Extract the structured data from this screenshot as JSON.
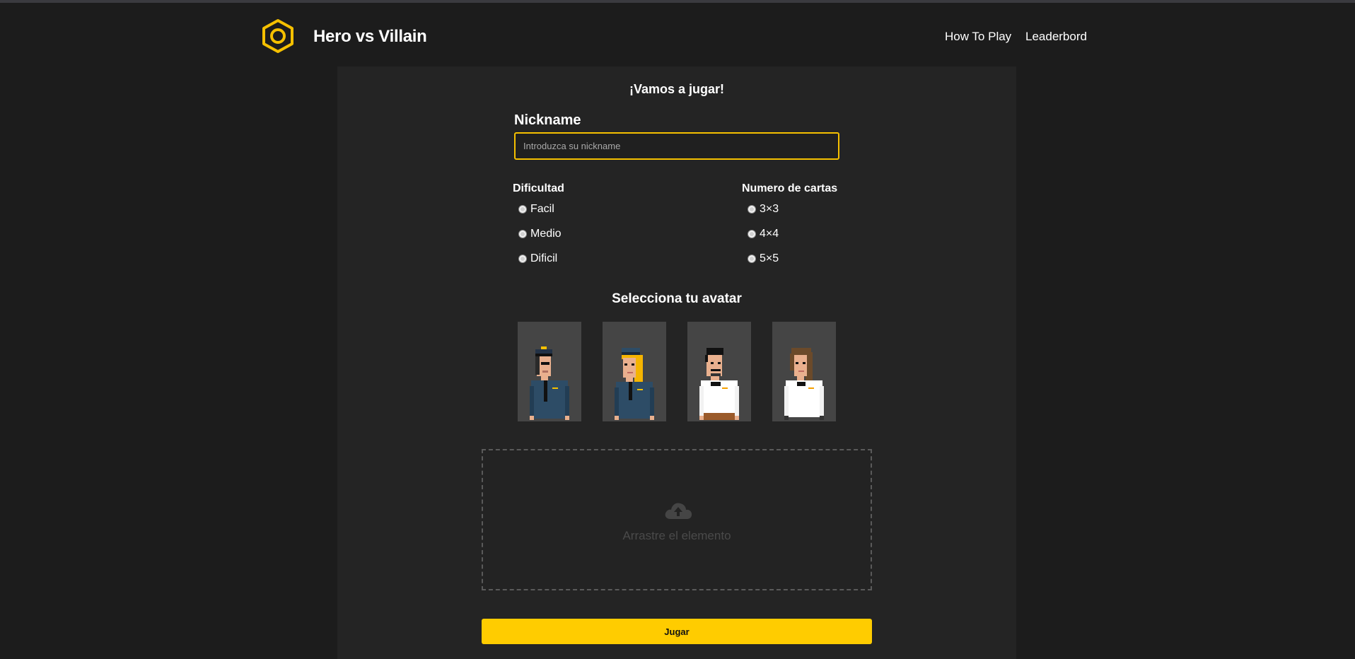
{
  "header": {
    "title": "Hero vs Villain",
    "nav": {
      "how_to_play": "How To Play",
      "leaderboard": "Leaderbord"
    }
  },
  "form": {
    "heading": "¡Vamos a jugar!",
    "nickname": {
      "label": "Nickname",
      "placeholder": "Introduzca su nickname",
      "value": ""
    },
    "difficulty": {
      "title": "Dificultad",
      "options": [
        "Facil",
        "Medio",
        "Dificil"
      ]
    },
    "cards": {
      "title": "Numero de cartas",
      "options": [
        "3×3",
        "4×4",
        "5×5"
      ]
    },
    "avatar": {
      "heading": "Selecciona tu avatar",
      "options": [
        "police-man-avatar",
        "police-woman-avatar",
        "waiter-man-avatar",
        "waiter-woman-avatar"
      ]
    },
    "dropzone": {
      "text": "Arrastre el elemento",
      "icon": "cloud-upload-icon"
    },
    "submit_label": "Jugar"
  },
  "colors": {
    "accent": "#ffcc00",
    "background": "#1c1c1c",
    "panel": "#242424",
    "avatar_tile": "#454545"
  }
}
